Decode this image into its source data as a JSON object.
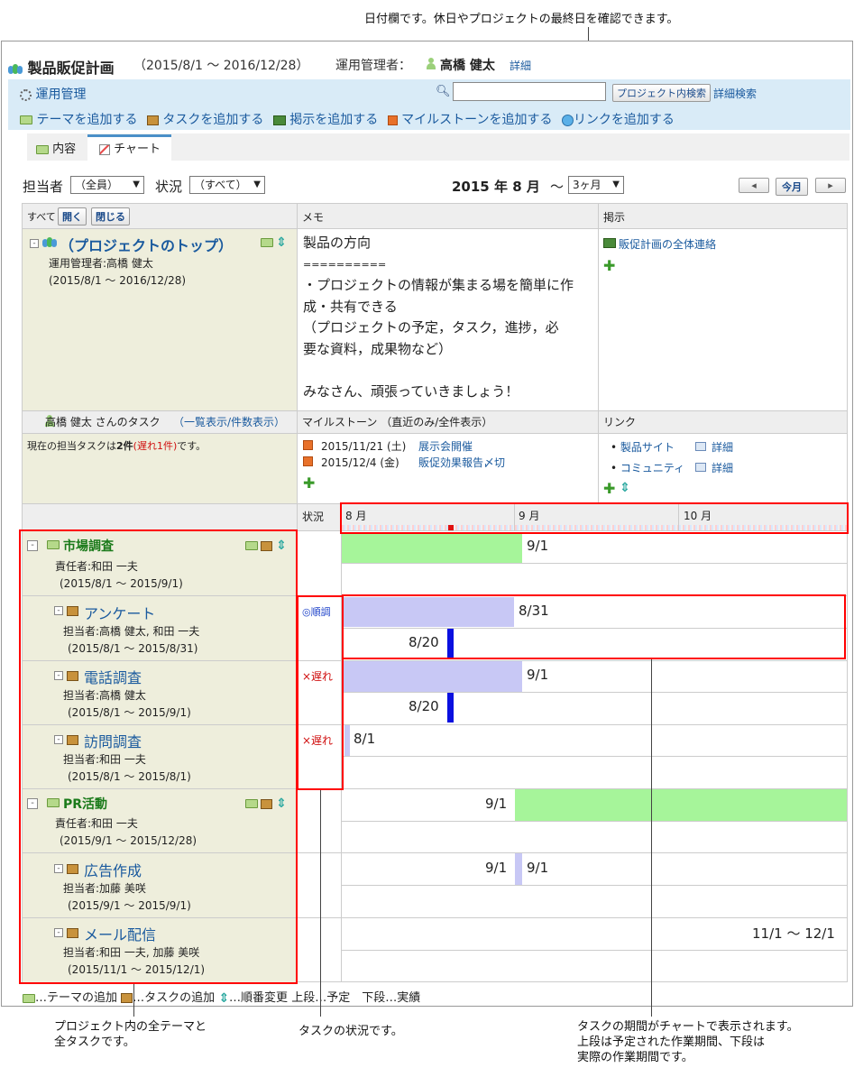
{
  "annotations": {
    "top": "日付欄です。休日やプロジェクトの最終日を確認できます。",
    "bottom_left": "プロジェクト内の全テーマと\n全タスクです。",
    "bottom_mid": "タスクの状況です。",
    "bottom_right": "タスクの期間がチャートで表示されます。\n上段は予定された作業期間、下段は\n実際の作業期間です。"
  },
  "project": {
    "title": "製品販促計画",
    "period": "（2015/8/1 ～ 2016/12/28）",
    "manager_label": "運用管理者：",
    "manager": "高橋 健太",
    "detail": "詳細"
  },
  "toolbar": {
    "admin": "運用管理",
    "search_placeholder": "",
    "search_button": "プロジェクト内検索",
    "adv_search": "詳細検索",
    "add_theme": "テーマを追加する",
    "add_task": "タスクを追加する",
    "add_board": "掲示を追加する",
    "add_milestone": "マイルストーンを追加する",
    "add_link": "リンクを追加する"
  },
  "tabs": {
    "content": "内容",
    "chart": "チャート"
  },
  "filters": {
    "assignee_label": "担当者",
    "assignee_value": "（全員）",
    "status_label": "状況",
    "status_value": "（すべて）",
    "date_title": "2015 年 8 月",
    "tilde": "～",
    "range_value": "3ヶ月",
    "prev": "◂",
    "today": "今月",
    "next": "▸"
  },
  "table": {
    "all": "すべて",
    "open": "開く",
    "close": "閉じる",
    "memo_header": "メモ",
    "board_header": "掲示",
    "status_header": "状況",
    "top_title": "（プロジェクトのトップ）",
    "top_manager": "運用管理者:高橋 健太",
    "top_period": "(2015/8/1 ～ 2016/12/28)",
    "memo_lines": [
      "製品の方向",
      "==========",
      "・プロジェクトの情報が集まる場を簡単に作",
      "成・共有できる",
      "（プロジェクトの予定，タスク，進捗，必",
      "要な資料，成果物など）",
      "",
      "みなさん、頑張っていきましょう！"
    ],
    "board_item": "販促計画の全体連絡",
    "mytask_user": "高橋 健太 さんのタスク",
    "mytask_links": "（一覧表示/件数表示）",
    "mytask_text_a": "現在の担当タスクは",
    "mytask_count": "2件",
    "mytask_late": "(遅れ1件)",
    "mytask_text_b": "です。",
    "ms_header": "マイルストーン （直近のみ/全件表示）",
    "milestones": [
      {
        "date": "2015/11/21 (土)",
        "name": "展示会開催"
      },
      {
        "date": "2015/12/4 (金)",
        "name": "販促効果報告〆切"
      }
    ],
    "link_header": "リンク",
    "links": [
      {
        "name": "製品サイト",
        "detail": "詳細"
      },
      {
        "name": "コミュニティ",
        "detail": "詳細"
      }
    ],
    "months": [
      "8 月",
      "9 月",
      "10 月"
    ]
  },
  "rows": [
    {
      "name": "市場調査",
      "role": "責任者:和田 一夫",
      "period": "(2015/8/1 ～ 2015/9/1)",
      "status": "",
      "plan_label": "9/1",
      "actual_label": ""
    },
    {
      "name": "アンケート",
      "role": "担当者:高橋 健太, 和田 一夫",
      "period": "(2015/8/1 ～ 2015/8/31)",
      "status": "◎順調",
      "plan_label": "8/31",
      "actual_label": "8/20"
    },
    {
      "name": "電話調査",
      "role": "担当者:高橋 健太",
      "period": "(2015/8/1 ～ 2015/9/1)",
      "status": "×遅れ",
      "plan_label": "9/1",
      "actual_label": "8/20"
    },
    {
      "name": "訪問調査",
      "role": "担当者:和田 一夫",
      "period": "(2015/8/1 ～ 2015/8/1)",
      "status": "×遅れ",
      "plan_label": "8/1",
      "actual_label": ""
    },
    {
      "name": "PR活動",
      "role": "責任者:和田 一夫",
      "period": "(2015/9/1 ～ 2015/12/28)",
      "status": "",
      "plan_label": "9/1",
      "actual_label": ""
    },
    {
      "name": "広告作成",
      "role": "担当者:加藤 美咲",
      "period": "(2015/9/1 ～ 2015/9/1)",
      "status": "",
      "plan_label_left": "9/1",
      "plan_label": "9/1",
      "actual_label": ""
    },
    {
      "name": "メール配信",
      "role": "担当者:和田 一夫, 加藤 美咲",
      "period": "(2015/11/1 ～ 2015/12/1)",
      "status": "",
      "plan_label": "11/1 ～ 12/1",
      "actual_label": ""
    }
  ],
  "legend": {
    "theme": "…テーマの追加",
    "task": "…タスクの追加",
    "order": "…順番変更",
    "rows": "上段…予定　下段…実績"
  },
  "colors": {
    "theme_bar": "#a6f59a",
    "task_bar": "#c8c8f5",
    "actual_bar": "#0a10e0",
    "highlight": "#ff0000"
  }
}
